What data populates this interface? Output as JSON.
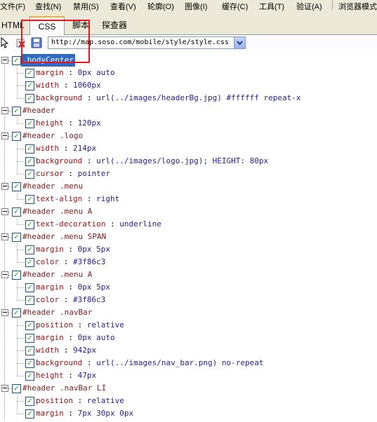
{
  "menubar": {
    "items": [
      "文件(F)",
      "查找(N)",
      "禁用(S)",
      "查看(V)",
      "轮廓(O)",
      "图像(I)",
      "缓存(C)",
      "工具(T)",
      "验证(A)",
      "浏览器模式"
    ]
  },
  "tabs": [
    {
      "label": "HTML",
      "active": false
    },
    {
      "label": "CSS",
      "active": true
    },
    {
      "label": "脚本",
      "active": false
    },
    {
      "label": "探查器",
      "active": false
    }
  ],
  "toolbar": {
    "url": "http://map.soso.com/mobile/style/style.css"
  },
  "colors": {
    "selection": "#316ac5",
    "highlight_box": "#e8151b",
    "selector": "#7b1b1b",
    "property": "#a01010",
    "value": "#1f1f8f",
    "check": "#21a121"
  },
  "rules": [
    {
      "selector": ".bodyCenter",
      "selected": true,
      "declarations": [
        {
          "prop": "margin",
          "value": "0px auto"
        },
        {
          "prop": "width",
          "value": "1060px"
        },
        {
          "prop": "background",
          "value": "url(../images/headerBg.jpg) #ffffff repeat-x"
        }
      ]
    },
    {
      "selector": "#header",
      "declarations": [
        {
          "prop": "height",
          "value": "120px"
        }
      ]
    },
    {
      "selector": "#header .logo",
      "declarations": [
        {
          "prop": "width",
          "value": "214px"
        },
        {
          "prop": "background",
          "value": "url(../images/logo.jpg); HEIGHT: 80px"
        },
        {
          "prop": "cursor",
          "value": "pointer"
        }
      ]
    },
    {
      "selector": "#header .menu",
      "declarations": [
        {
          "prop": "text-align",
          "value": "right"
        }
      ]
    },
    {
      "selector": "#header .menu A",
      "declarations": [
        {
          "prop": "text-decoration",
          "value": "underline"
        }
      ]
    },
    {
      "selector": "#header .menu SPAN",
      "declarations": [
        {
          "prop": "margin",
          "value": "0px 5px"
        },
        {
          "prop": "color",
          "value": "#3f86c3"
        }
      ]
    },
    {
      "selector": "#header .menu A",
      "declarations": [
        {
          "prop": "margin",
          "value": "0px 5px"
        },
        {
          "prop": "color",
          "value": "#3f86c3"
        }
      ]
    },
    {
      "selector": "#header .navBar",
      "declarations": [
        {
          "prop": "position",
          "value": "relative"
        },
        {
          "prop": "margin",
          "value": "0px auto"
        },
        {
          "prop": "width",
          "value": "942px"
        },
        {
          "prop": "background",
          "value": "url(../images/nav_bar.png) no-repeat"
        },
        {
          "prop": "height",
          "value": "47px"
        }
      ]
    },
    {
      "selector": "#header .navBar LI",
      "declarations": [
        {
          "prop": "position",
          "value": "relative"
        },
        {
          "prop": "margin",
          "value": "7px 30px 0px"
        }
      ]
    }
  ]
}
